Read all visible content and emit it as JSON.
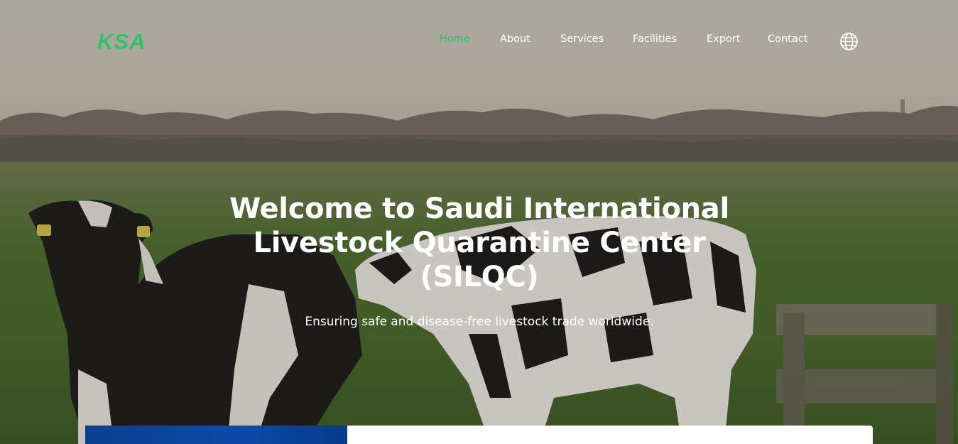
{
  "brand": {
    "logo_text": "KSA",
    "accent_color": "#22c36a"
  },
  "nav": {
    "items": [
      {
        "label": "Home",
        "active": true
      },
      {
        "label": "About",
        "active": false
      },
      {
        "label": "Services",
        "active": false
      },
      {
        "label": "Facilities",
        "active": false
      },
      {
        "label": "Export",
        "active": false
      },
      {
        "label": "Contact",
        "active": false
      }
    ],
    "language_icon": "globe-icon"
  },
  "hero": {
    "title": "Welcome to Saudi International Livestock Quarantine Center (SILQC)",
    "subtitle": "Ensuring safe and disease-free livestock trade worldwide."
  },
  "colors": {
    "card_blue": "#0b4aa8",
    "card_white": "#ffffff"
  }
}
